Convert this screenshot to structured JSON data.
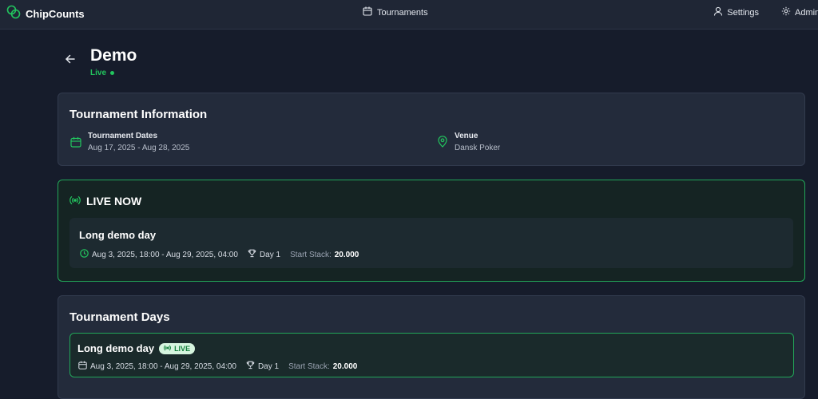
{
  "app": {
    "name": "ChipCounts"
  },
  "nav": {
    "tournaments": "Tournaments",
    "settings": "Settings",
    "admin": "Admin"
  },
  "page": {
    "title": "Demo",
    "status": "Live"
  },
  "info": {
    "heading": "Tournament Information",
    "dates_label": "Tournament Dates",
    "dates_value": "Aug 17, 2025 - Aug 28, 2025",
    "venue_label": "Venue",
    "venue_value": "Dansk Poker"
  },
  "live_now": {
    "heading": "LIVE NOW",
    "day_name": "Long demo day",
    "time_range": "Aug 3, 2025, 18:00 - Aug 29, 2025, 04:00",
    "day": "Day 1",
    "start_stack_label": "Start Stack:",
    "start_stack_value": "20.000"
  },
  "days": {
    "heading": "Tournament Days",
    "items": [
      {
        "name": "Long demo day",
        "badge": "LIVE",
        "time_range": "Aug 3, 2025, 18:00 - Aug 29, 2025, 04:00",
        "day": "Day 1",
        "start_stack_label": "Start Stack:",
        "start_stack_value": "20.000"
      }
    ]
  },
  "colors": {
    "accent": "#22c55e",
    "background": "#161c2b",
    "card": "#232b3b"
  },
  "icons": {
    "brand": "chips-icon",
    "tournaments": "calendar-icon",
    "settings": "user-icon",
    "admin": "gear-icon",
    "back": "arrow-left-icon",
    "dates": "calendar-icon",
    "venue": "map-pin-icon",
    "live": "broadcast-icon",
    "time": "clock-icon",
    "day": "trophy-icon"
  }
}
